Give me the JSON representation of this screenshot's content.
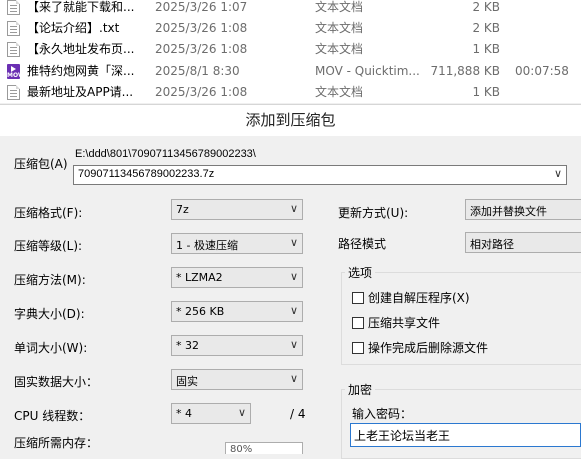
{
  "file_list": {
    "rows": [
      {
        "icon": "text-file-icon",
        "name": "【来了就能下载和...",
        "date": "2025/3/26 1:07",
        "type": "文本文档",
        "size": "2 KB",
        "duration": ""
      },
      {
        "icon": "text-file-icon",
        "name": "【论坛介绍】.txt",
        "date": "2025/3/26 1:08",
        "type": "文本文档",
        "size": "2 KB",
        "duration": ""
      },
      {
        "icon": "text-file-icon",
        "name": "【永久地址发布页...",
        "date": "2025/3/26 1:08",
        "type": "文本文档",
        "size": "1 KB",
        "duration": ""
      },
      {
        "icon": "mov-file-icon",
        "name": "推特约炮网黄「深...",
        "date": "2025/8/1 8:30",
        "type": "MOV - Quicktim...",
        "size": "711,888 KB",
        "duration": "00:07:58"
      },
      {
        "icon": "text-file-icon",
        "name": "最新地址及APP请...",
        "date": "2025/3/26 1:08",
        "type": "文本文档",
        "size": "1 KB",
        "duration": ""
      }
    ],
    "mov_icon_text": "MOV"
  },
  "dialog": {
    "title": "添加到压缩包",
    "archive_label": "压缩包(A)",
    "archive_path": "E:\\ddd\\801\\70907113456789002233\\",
    "archive_name": "70907113456789002233.7z",
    "format_label": "压缩格式(F):",
    "format_value": "7z",
    "level_label": "压缩等级(L):",
    "level_value": "1 - 极速压缩",
    "method_label": "压缩方法(M):",
    "method_value": "* LZMA2",
    "dict_label": "字典大小(D):",
    "dict_value": "* 256 KB",
    "word_label": "单词大小(W):",
    "word_value": "* 32",
    "solid_label": "固实数据大小：",
    "solid_value": "固实",
    "threads_label": "CPU 线程数：",
    "threads_value": "* 4",
    "threads_max": "/ 4",
    "memory_label": "压缩所需内存：",
    "memory_value": "80%",
    "update_label": "更新方式(U):",
    "update_value": "添加并替换文件",
    "pathmode_label": "路径模式",
    "pathmode_value": "相对路径",
    "options_title": "选项",
    "options": [
      {
        "label": "创建自解压程序(X)",
        "checked": false
      },
      {
        "label": "压缩共享文件",
        "checked": false
      },
      {
        "label": "操作完成后删除源文件",
        "checked": false
      }
    ],
    "encryption_title": "加密",
    "password_label": "输入密码：",
    "password_value": "上老王论坛当老王"
  }
}
